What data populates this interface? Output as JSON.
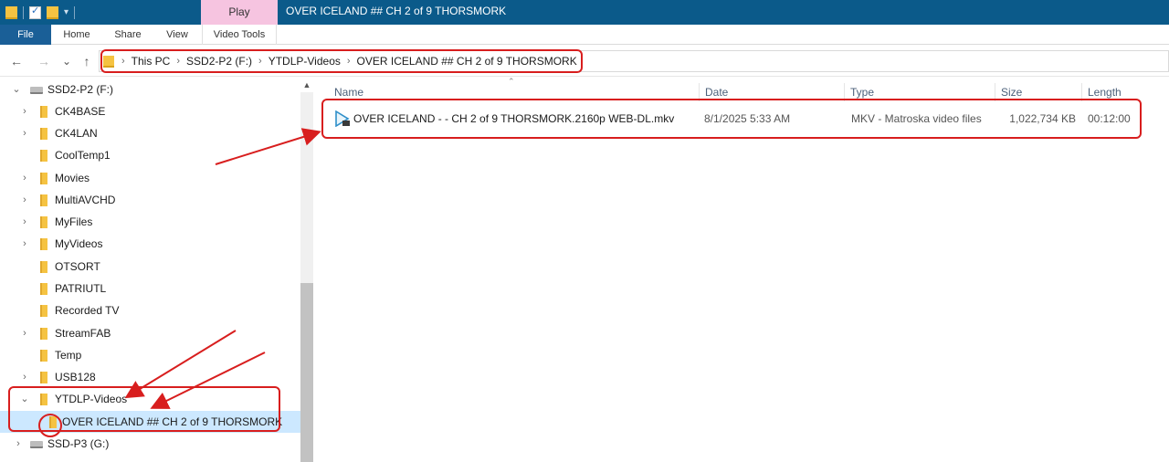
{
  "window": {
    "title": "OVER ICELAND ## CH 2 of 9  THORSMORK",
    "context_tab": "Play"
  },
  "ribbon": {
    "tabs": [
      "File",
      "Home",
      "Share",
      "View",
      "Video Tools"
    ]
  },
  "nav": {
    "back_icon": "←",
    "forward_icon": "→",
    "recent_icon": "⌄",
    "up_icon": "↑"
  },
  "address": {
    "crumbs": [
      "This PC",
      "SSD2-P2 (F:)",
      "YTDLP-Videos",
      "OVER ICELAND ## CH 2 of 9  THORSMORK"
    ]
  },
  "tree": [
    {
      "label": "SSD2-P2 (F:)",
      "type": "drive",
      "expander": "⌄",
      "level": 0
    },
    {
      "label": "CK4BASE",
      "type": "folder",
      "expander": "›",
      "level": 1
    },
    {
      "label": "CK4LAN",
      "type": "folder",
      "expander": "›",
      "level": 1
    },
    {
      "label": "CoolTemp1",
      "type": "folder",
      "expander": "",
      "level": 1
    },
    {
      "label": "Movies",
      "type": "folder",
      "expander": "›",
      "level": 1
    },
    {
      "label": "MultiAVCHD",
      "type": "folder",
      "expander": "›",
      "level": 1
    },
    {
      "label": "MyFiles",
      "type": "folder",
      "expander": "›",
      "level": 1
    },
    {
      "label": "MyVideos",
      "type": "folder",
      "expander": "›",
      "level": 1
    },
    {
      "label": "OTSORT",
      "type": "folder",
      "expander": "",
      "level": 1
    },
    {
      "label": "PATRIUTL",
      "type": "folder",
      "expander": "",
      "level": 1
    },
    {
      "label": "Recorded TV",
      "type": "folder",
      "expander": "",
      "level": 1
    },
    {
      "label": "StreamFAB",
      "type": "folder",
      "expander": "›",
      "level": 1
    },
    {
      "label": "Temp",
      "type": "folder",
      "expander": "",
      "level": 1
    },
    {
      "label": "USB128",
      "type": "folder",
      "expander": "›",
      "level": 1
    },
    {
      "label": "YTDLP-Videos",
      "type": "folder",
      "expander": "⌄",
      "level": 1
    },
    {
      "label": "OVER ICELAND ## CH 2 of 9  THORSMORK",
      "type": "folder",
      "expander": "",
      "level": 2,
      "selected": true
    },
    {
      "label": "SSD-P3 (G:)",
      "type": "drive",
      "expander": "›",
      "level": 0
    }
  ],
  "columns": [
    "Name",
    "Date",
    "Type",
    "Size",
    "Length"
  ],
  "files": [
    {
      "name": "OVER ICELAND  - - CH 2 of 9  THORSMORK.2160p WEB-DL.mkv",
      "date": "8/1/2025 5:33 AM",
      "type": "MKV - Matroska video files",
      "size": "1,022,734 KB",
      "length": "00:12:00"
    }
  ],
  "colors": {
    "titlebar": "#0b5a8a",
    "play_context": "#f6c4e0",
    "annotation_red": "#d81e1e",
    "selection": "#cce8ff"
  }
}
